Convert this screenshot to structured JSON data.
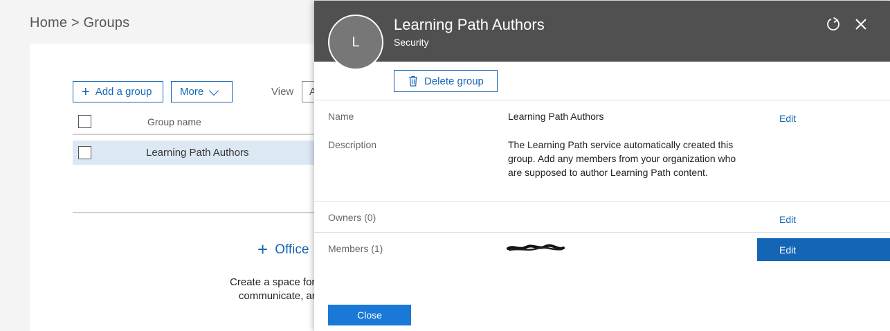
{
  "breadcrumb": "Home > Groups",
  "toolbar": {
    "add_group_icon": "+",
    "add_group_label": "Add a group",
    "more_label": "More",
    "view_label": "View",
    "view_value": "A"
  },
  "table": {
    "column_header": "Group name",
    "rows": [
      {
        "name": "Learning Path Authors"
      }
    ]
  },
  "empty_state": {
    "icon": "+",
    "link_label": "Office",
    "text_line1": "Create a space for a",
    "text_line2": "communicate, an"
  },
  "panel": {
    "avatar_initial": "L",
    "title": "Learning Path Authors",
    "subtitle": "Security",
    "delete_label": "Delete group",
    "name_label": "Name",
    "name_value": "Learning Path Authors",
    "description_label": "Description",
    "description_value": "The Learning Path service automatically created this group. Add any members from your organization who are supposed to author Learning Path content.",
    "owners_label": "Owners (0)",
    "members_label": "Members (1)",
    "edit_label": "Edit",
    "close_label": "Close"
  },
  "colors": {
    "accent": "#1565b7",
    "header_bg": "#505050",
    "selected_row": "#dce8f4"
  }
}
